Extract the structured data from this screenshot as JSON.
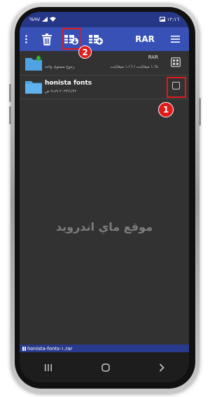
{
  "status_bar": {
    "left_text": "%٩V",
    "time": "١٢:١٦"
  },
  "toolbar": {
    "title": "RAR"
  },
  "rows": [
    {
      "name": "RAR",
      "subtitle_left": "رجوع مستوى واحد",
      "subtitle_right": "١،٦٤ ميغابايت / ١،١٦ ميغابايت"
    },
    {
      "name": "honista fonts",
      "subtitle": "٢٠٢٣/١/٢٢ ٩:٤٩ ص"
    }
  ],
  "annotations": {
    "badge_1": "1",
    "badge_2": "2"
  },
  "watermark": "موقع ماي اندرويد",
  "bottom_bar": {
    "filename": "honista-fonts-١.rar"
  },
  "colors": {
    "toolbar": "#3851b6",
    "status_bar": "#273787",
    "background": "#323232",
    "folder": "#4fa3e3",
    "highlight": "#e11a1a"
  }
}
